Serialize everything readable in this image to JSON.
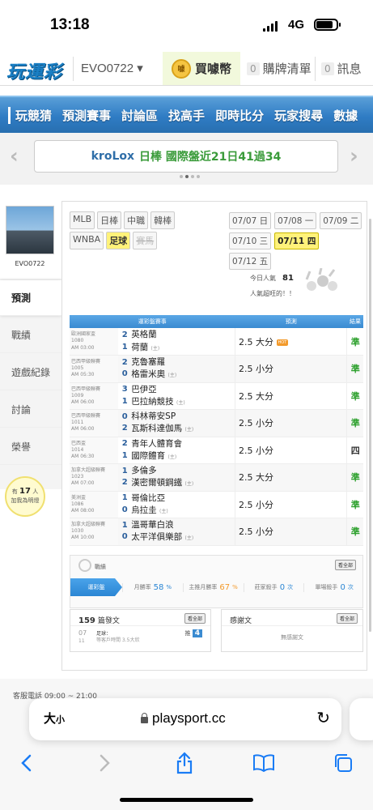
{
  "status_bar": {
    "time": "13:18",
    "network": "4G",
    "battery_level": 0.85
  },
  "top_nav": {
    "logo": "玩運彩",
    "username": "EVO0722",
    "coin_label": "買噱幣",
    "coin_icon_text": "噱",
    "ticket_count": "0",
    "ticket_label": "購牌清單",
    "msg_count": "0",
    "msg_label": "訊息"
  },
  "blue_menu": [
    "玩競猜",
    "預測賽事",
    "討論區",
    "找高手",
    "即時比分",
    "玩家搜尋",
    "數據"
  ],
  "banner": {
    "user": "kroLox",
    "text": "日棒 國際盤近21日41過34"
  },
  "sidebar": {
    "username": "EVO0722",
    "tabs": [
      "預測",
      "戰績",
      "遊戲紀錄",
      "討論",
      "榮譽"
    ],
    "fans_prefix": "有",
    "fans_count": "17",
    "fans_unit": "人",
    "fans_suffix": "加我為明燈"
  },
  "league_tags": [
    {
      "label": "MLB",
      "state": "normal"
    },
    {
      "label": "日棒",
      "state": "normal"
    },
    {
      "label": "中職",
      "state": "normal"
    },
    {
      "label": "韓棒",
      "state": "normal"
    },
    {
      "label": "WNBA",
      "state": "normal"
    },
    {
      "label": "足球",
      "state": "selected"
    },
    {
      "label": "賽馬",
      "state": "disabled"
    }
  ],
  "dates": [
    {
      "label": "07/07 日",
      "selected": false
    },
    {
      "label": "07/08 一",
      "selected": false
    },
    {
      "label": "07/09 二",
      "selected": false
    },
    {
      "label": "07/10 三",
      "selected": false
    },
    {
      "label": "07/11 四",
      "selected": true
    },
    {
      "label": "07/12 五",
      "selected": false
    }
  ],
  "popularity": {
    "label": "今日人氣",
    "value": "81",
    "caption": "人氣超旺的！！"
  },
  "table": {
    "headers": [
      "運彩盤賽事",
      "預測",
      "結果"
    ],
    "rows": [
      {
        "league": "歐洲國家盃",
        "code": "1080",
        "time": "AM 03:00",
        "s1": "2",
        "s2": "1",
        "t1": "英格蘭",
        "t2": "荷蘭",
        "t2_tag": "(主)",
        "pred": "2.5 大分",
        "hot": "HOT",
        "res": "準"
      },
      {
        "league": "巴西甲級聯賽",
        "code": "1005",
        "time": "AM 05:30",
        "s1": "2",
        "s2": "0",
        "t1": "克魯塞羅",
        "t2": "格雷米奧",
        "t2_tag": "(主)",
        "pred": "2.5 小分",
        "hot": "",
        "res": "準"
      },
      {
        "league": "巴西甲級聯賽",
        "code": "1009",
        "time": "AM 06:00",
        "s1": "3",
        "s2": "1",
        "t1": "巴伊亞",
        "t2": "巴拉納競技",
        "t2_tag": "(主)",
        "pred": "2.5 大分",
        "hot": "",
        "res": "準"
      },
      {
        "league": "巴西甲級聯賽",
        "code": "1011",
        "time": "AM 06:00",
        "s1": "0",
        "s2": "2",
        "t1": "科林蒂安SP",
        "t2": "瓦斯科達伽馬",
        "t2_tag": "(主)",
        "pred": "2.5 小分",
        "hot": "",
        "res": "準"
      },
      {
        "league": "巴西盃",
        "code": "1014",
        "time": "AM 06:30",
        "s1": "2",
        "s2": "1",
        "t1": "青年人體育會",
        "t2": "國際體育",
        "t2_tag": "(主)",
        "pred": "2.5 小分",
        "hot": "",
        "res": "四"
      },
      {
        "league": "加拿大超級聯賽",
        "code": "1023",
        "time": "AM 07:00",
        "s1": "1",
        "s2": "2",
        "t1": "多倫多",
        "t2": "漢密爾頓鋼鐵",
        "t2_tag": "(主)",
        "pred": "2.5 大分",
        "hot": "",
        "res": "準"
      },
      {
        "league": "美洲盃",
        "code": "1086",
        "time": "AM 08:00",
        "s1": "1",
        "s2": "0",
        "t1": "哥倫比亞",
        "t2": "烏拉圭",
        "t2_tag": "(主)",
        "pred": "2.5 小分",
        "hot": "",
        "res": "準"
      },
      {
        "league": "加拿大超級聯賽",
        "code": "1030",
        "time": "AM 10:00",
        "s1": "1",
        "s2": "0",
        "t1": "溫哥華白浪",
        "t2": "太平洋俱樂部",
        "t2_tag": "(主)",
        "pred": "2.5 小分",
        "hot": "",
        "res": "準"
      }
    ]
  },
  "stats": {
    "title": "戰績",
    "view_all": "看全部",
    "ribbon": "運彩盤",
    "items": [
      {
        "label": "月勝率",
        "value": "58",
        "unit": "%",
        "color": "#2b86d4"
      },
      {
        "label": "主推月勝率",
        "value": "67",
        "unit": "%",
        "color": "#f39a2b"
      },
      {
        "label": "莊家殺手",
        "value": "0",
        "unit": "次",
        "color": "#2b86d4"
      },
      {
        "label": "單場殺手",
        "value": "0",
        "unit": "次",
        "color": "#2b86d4"
      }
    ]
  },
  "posts_box": {
    "count": "159",
    "label": "篇發文",
    "view_all": "看全部",
    "date_month": "07",
    "date_day": "11",
    "post_title": "足球：",
    "post_meta": "等客戶時間 3.5大欣",
    "badge_prefix": "推",
    "badge_value": "4"
  },
  "thanks_box": {
    "label": "感謝文",
    "view_all": "看全部",
    "empty_text": "無感謝文"
  },
  "footer_text": "客服電話 09:00 ~ 21:00",
  "safari": {
    "aa_big": "大",
    "aa_small": "小",
    "url": "playsport.cc"
  }
}
